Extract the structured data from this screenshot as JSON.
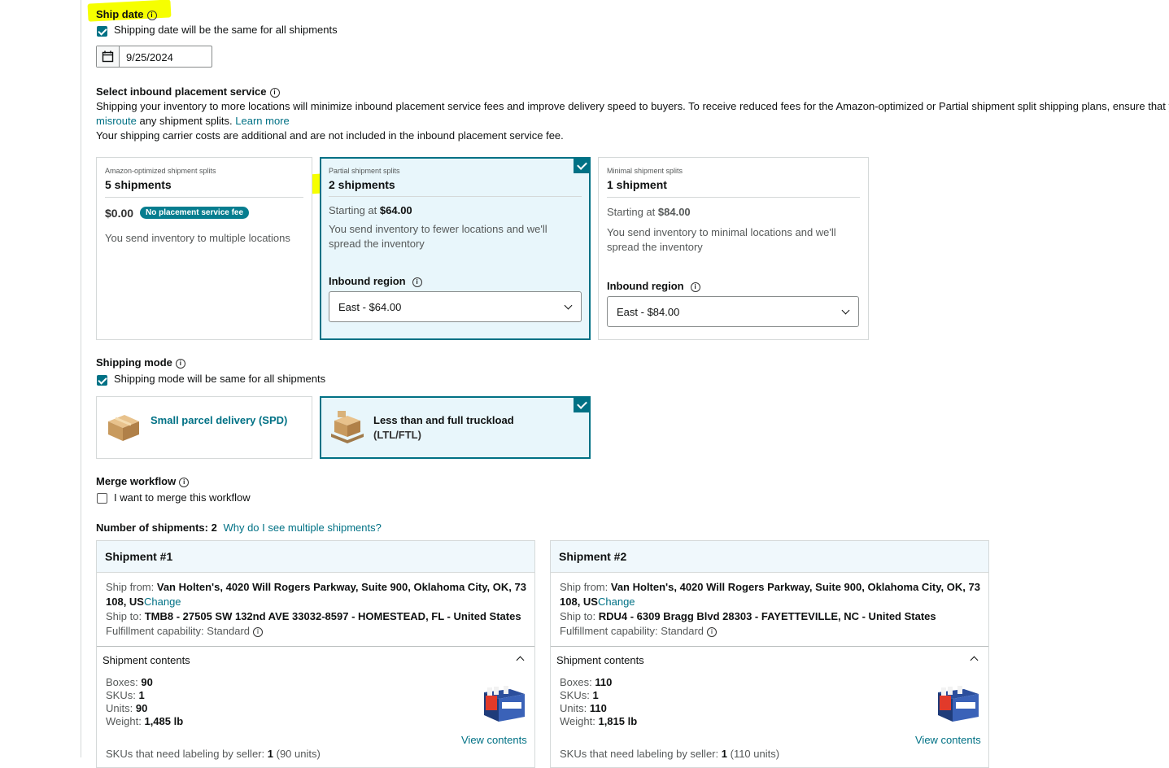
{
  "ship_date": {
    "label": "Ship date",
    "same_checkbox_label": "Shipping date will be the same for all shipments",
    "date_value": "9/25/2024"
  },
  "placement": {
    "title": "Select inbound placement service",
    "desc1": "Shipping your inventory to more locations will minimize inbound placement service fees and improve delivery speed to buyers. To receive reduced fees for the Amazon-optimized or Partial shipment split shipping plans, ensure that y",
    "misroute": "misroute",
    "desc2_rest": " any shipment splits. ",
    "learn_more": "Learn more",
    "desc3": "Your shipping carrier costs are additional and are not included in the inbound placement service fee.",
    "options": [
      {
        "small": "Amazon-optimized shipment splits",
        "big": "5 shipments",
        "price": "$0.00",
        "badge": "No placement service fee",
        "desc": "You send inventory to multiple locations"
      },
      {
        "small": "Partial shipment splits",
        "big": "2 shipments",
        "starting": "Starting at",
        "price": "$64.00",
        "desc_l1": "You send inventory to fewer locations and we'll",
        "desc_l2": "spread the inventory",
        "region_label": "Inbound region",
        "region_value": "East - $64.00"
      },
      {
        "small": "Minimal shipment splits",
        "big": "1 shipment",
        "starting": "Starting at",
        "price": "$84.00",
        "desc_l1": "You send inventory to minimal locations and we'll",
        "desc_l2": "spread the inventory",
        "region_label": "Inbound region",
        "region_value": "East - $84.00"
      }
    ]
  },
  "shipping_mode": {
    "label": "Shipping mode",
    "same_checkbox_label": "Shipping mode will be same for all shipments",
    "spd_label": "Small parcel delivery (SPD)",
    "ltl_l1": "Less than and full truckload",
    "ltl_l2": "(LTL/FTL)"
  },
  "merge": {
    "label": "Merge workflow",
    "checkbox_label": "I want to merge this workflow"
  },
  "num_shipments": {
    "label": "Number of shipments:",
    "count": "2",
    "why_link": "Why do I see multiple shipments?"
  },
  "shipments": [
    {
      "title": "Shipment #1",
      "from_label": "Ship from:",
      "from_l1": "Van Holten's, 4020 Will Rogers Parkway, Suite 900, Oklahoma City, OK, 73",
      "from_l2": "108, US",
      "change": "Change",
      "to_label": "Ship to:",
      "to_value": "TMB8 - 27505 SW 132nd AVE 33032-8597 - HOMESTEAD, FL - United States",
      "fc_label": "Fulfillment capability: Standard",
      "contents_label": "Shipment contents",
      "boxes_label": "Boxes:",
      "boxes": "90",
      "skus_label": "SKUs:",
      "skus": "1",
      "units_label": "Units:",
      "units": "90",
      "weight_label": "Weight:",
      "weight": "1,485 lb",
      "view_contents": "View contents",
      "labeling_label": "SKUs that need labeling by seller:",
      "labeling_count": "1",
      "labeling_units": "(90 units)"
    },
    {
      "title": "Shipment #2",
      "from_label": "Ship from:",
      "from_l1": "Van Holten's, 4020 Will Rogers Parkway, Suite 900, Oklahoma City, OK, 73",
      "from_l2": "108, US",
      "change": "Change",
      "to_label": "Ship to:",
      "to_value": "RDU4 - 6309 Bragg Blvd 28303 - FAYETTEVILLE, NC - United States",
      "fc_label": "Fulfillment capability: Standard",
      "contents_label": "Shipment contents",
      "boxes_label": "Boxes:",
      "boxes": "110",
      "skus_label": "SKUs:",
      "skus": "1",
      "units_label": "Units:",
      "units": "110",
      "weight_label": "Weight:",
      "weight": "1,815 lb",
      "view_contents": "View contents",
      "labeling_label": "SKUs that need labeling by seller:",
      "labeling_count": "1",
      "labeling_units": "(110 units)"
    }
  ],
  "colors": {
    "accent": "#007185",
    "highlight": "#f6ff00",
    "selected_bg": "#e8f6fb"
  }
}
